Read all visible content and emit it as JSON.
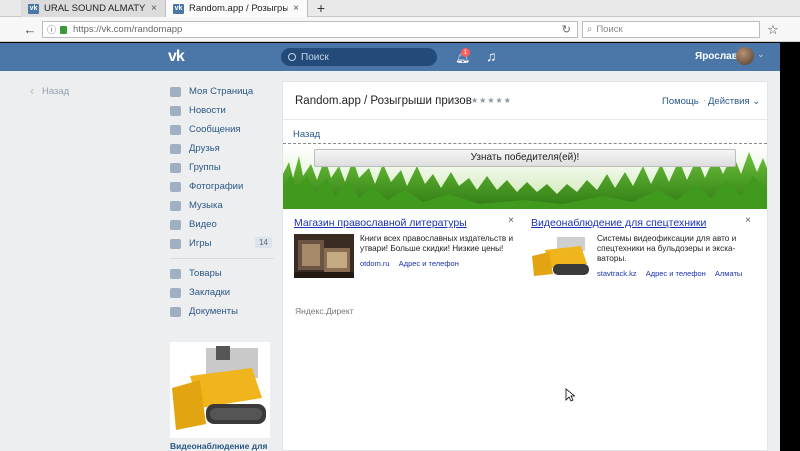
{
  "browser": {
    "tabs": [
      {
        "title": "URAL SOUND ALMATY",
        "active": false
      },
      {
        "title": "Random.app / Розыгрыши пр",
        "active": true
      }
    ],
    "url": "https://vk.com/randomapp",
    "search_placeholder": "Поиск"
  },
  "vk_header": {
    "search_placeholder": "Поиск",
    "notification_count": "1",
    "user_name": "Ярослав"
  },
  "back_link": "Назад",
  "left_nav": {
    "items": [
      {
        "label": "Моя Страница",
        "icon": "home-icon"
      },
      {
        "label": "Новости",
        "icon": "news-icon"
      },
      {
        "label": "Сообщения",
        "icon": "messages-icon"
      },
      {
        "label": "Друзья",
        "icon": "friends-icon"
      },
      {
        "label": "Группы",
        "icon": "groups-icon"
      },
      {
        "label": "Фотографии",
        "icon": "camera-icon"
      },
      {
        "label": "Музыка",
        "icon": "music-icon"
      },
      {
        "label": "Видео",
        "icon": "video-icon"
      },
      {
        "label": "Игры",
        "icon": "games-icon",
        "count": "14"
      }
    ],
    "items2": [
      {
        "label": "Товары",
        "icon": "bag-icon"
      },
      {
        "label": "Закладки",
        "icon": "star-icon"
      },
      {
        "label": "Документы",
        "icon": "doc-icon"
      }
    ],
    "ad_caption": "Видеонаблюдение для"
  },
  "app": {
    "title": "Random.app / Розыгрыши призов",
    "rating_stars": "★★★★★",
    "help": "Помощь",
    "actions": "Действия",
    "frame_back": "Назад",
    "winner_button": "Узнать победителя(ей)!"
  },
  "ads": [
    {
      "title": "Магазин православной литературы",
      "text": "Книги всех православных издательств и утвари! Больше скидки! Низкие цены!",
      "domain": "otdom.ru",
      "links": [
        "Адрес и телефон"
      ]
    },
    {
      "title": "Видеонаблюдение для спецтехники",
      "text": "Системы видеофиксации для авто и спецтехники на бульдозеры и экска-ваторы.",
      "domain": "stavtrack.kz",
      "links": [
        "Адрес и телефон",
        "Алматы"
      ]
    }
  ],
  "yandex_direct": "Яндекс.Директ",
  "colors": {
    "vk_blue": "#4a76a8",
    "link_blue": "#2a5885",
    "ad_link": "#1a33b0"
  }
}
